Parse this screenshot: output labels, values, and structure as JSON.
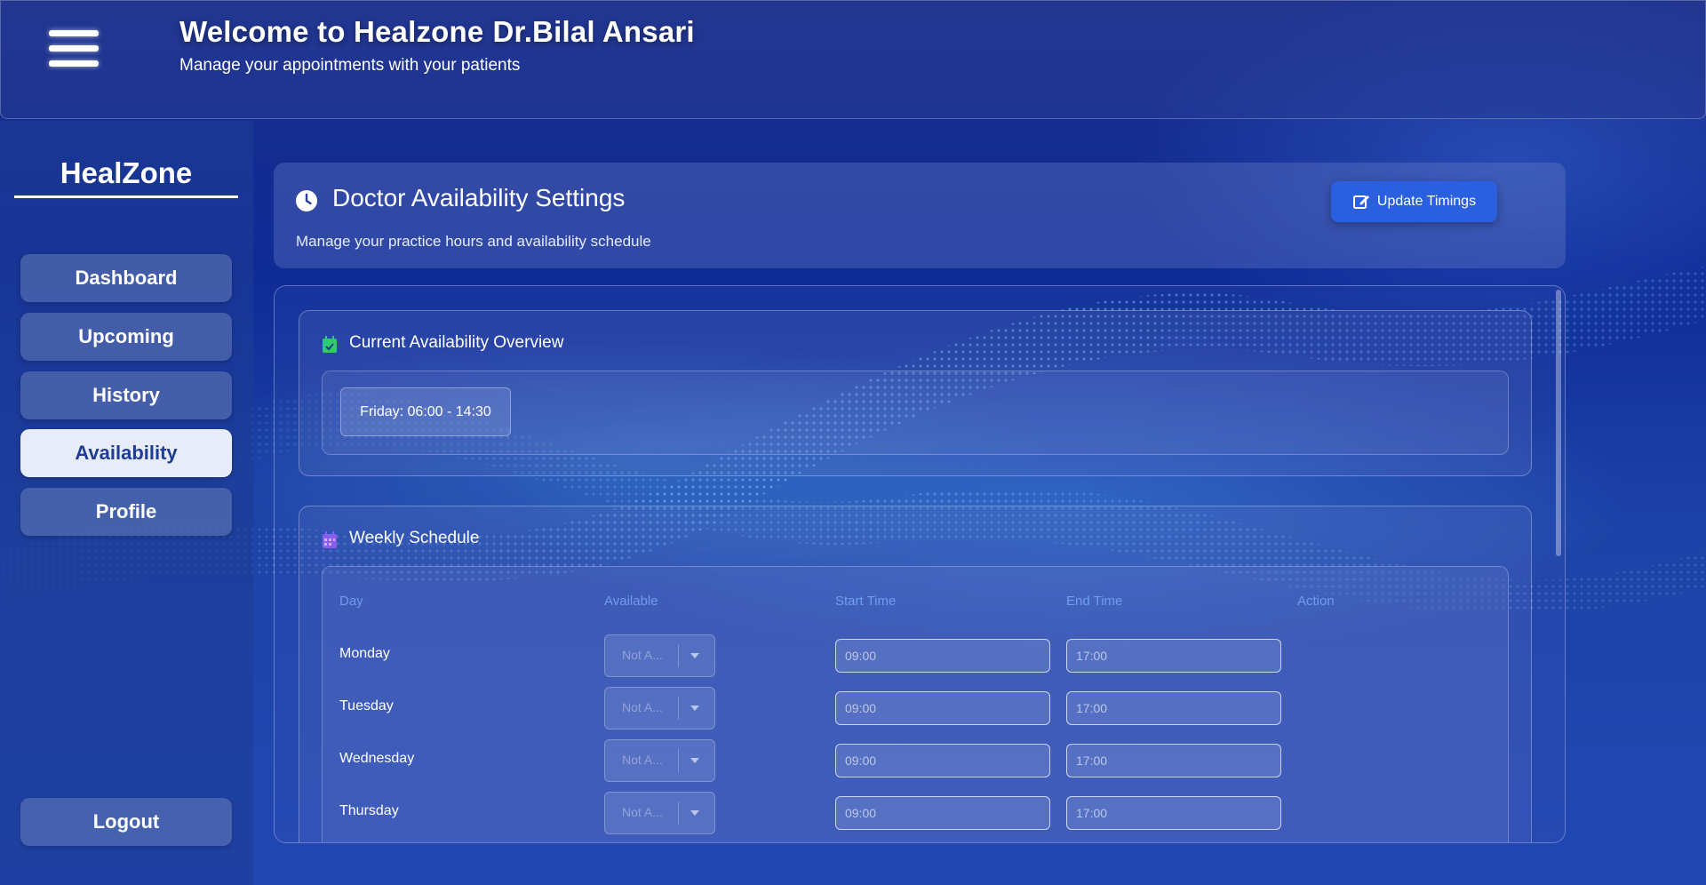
{
  "header": {
    "title": "Welcome to Healzone",
    "doctor_name": "Dr.Bilal Ansari",
    "subtitle": "Manage your appointments with your patients"
  },
  "sidebar": {
    "brand": "HealZone",
    "items": [
      {
        "label": "Dashboard",
        "active": false
      },
      {
        "label": "Upcoming",
        "active": false
      },
      {
        "label": "History",
        "active": false
      },
      {
        "label": "Availability",
        "active": true
      },
      {
        "label": "Profile",
        "active": false
      }
    ],
    "logout_label": "Logout"
  },
  "settings": {
    "icon": "clock-icon",
    "title": "Doctor Availability Settings",
    "subtitle": "Manage your practice hours and availability schedule",
    "update_button": "Update Timings"
  },
  "overview": {
    "icon": "calendar-check-icon",
    "title": "Current Availability Overview",
    "entries": [
      "Friday: 06:00 - 14:30"
    ]
  },
  "weekly": {
    "icon": "calendar-icon",
    "title": "Weekly Schedule",
    "columns": [
      "Day",
      "Available",
      "Start Time",
      "End Time",
      "Action"
    ],
    "rows": [
      {
        "day": "Monday",
        "available": "Not A...",
        "start": "09:00",
        "end": "17:00"
      },
      {
        "day": "Tuesday",
        "available": "Not A...",
        "start": "09:00",
        "end": "17:00"
      },
      {
        "day": "Wednesday",
        "available": "Not A...",
        "start": "09:00",
        "end": "17:00"
      },
      {
        "day": "Thursday",
        "available": "Not A...",
        "start": "09:00",
        "end": "17:00"
      }
    ]
  },
  "colors": {
    "accent": "#2a5fe0",
    "active_nav_bg": "#e8ecf8",
    "table_header": "#6f9bf0",
    "check_green": "#2ecc71",
    "calendar_purple": "#8a5cf0"
  }
}
